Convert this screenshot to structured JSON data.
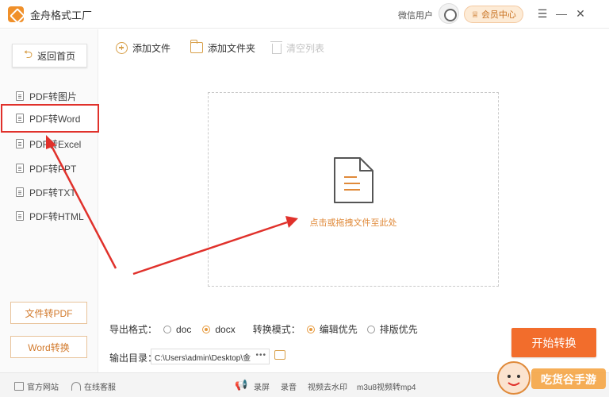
{
  "titlebar": {
    "app_title": "金舟格式工厂",
    "user_name": "微信用户",
    "member_center": "会员中心",
    "menu_glyph": "☰",
    "minimize_glyph": "—",
    "close_glyph": "✕"
  },
  "sidebar": {
    "back_label": "返回首页",
    "items": [
      {
        "label": "PDF转图片",
        "active": false
      },
      {
        "label": "PDF转Word",
        "active": true
      },
      {
        "label": "PDF转Excel",
        "active": false
      },
      {
        "label": "PDF转PPT",
        "active": false
      },
      {
        "label": "PDF转TXT",
        "active": false
      },
      {
        "label": "PDF转HTML",
        "active": false
      }
    ],
    "file_to_pdf": "文件转PDF",
    "word_convert": "Word转换"
  },
  "toolbar": {
    "add_file": "添加文件",
    "add_folder": "添加文件夹",
    "clear_list": "清空列表"
  },
  "drop_zone": {
    "hint": "点击或拖拽文件至此处"
  },
  "settings": {
    "export_format_label": "导出格式：",
    "format_options": [
      {
        "label": "doc",
        "checked": false
      },
      {
        "label": "docx",
        "checked": true
      }
    ],
    "mode_label": "转换模式：",
    "mode_options": [
      {
        "label": "编辑优先",
        "checked": true
      },
      {
        "label": "排版优先",
        "checked": false
      }
    ],
    "output_dir_label": "输出目录：",
    "output_dir_value": "C:\\Users\\admin\\Desktop\\金",
    "output_more": "•••",
    "start_button": "开始转换"
  },
  "footer": {
    "website": "官方网站",
    "support": "在线客服",
    "record_screen": "录屏",
    "record_audio": "录音",
    "remove_watermark": "视频去水印",
    "m3u8": "m3u8视频转mp4"
  },
  "watermark": {
    "text": "吃货谷手游"
  },
  "colors": {
    "accent": "#f26d2c",
    "highlight": "#e0312b",
    "brand_orange": "#e08a3a"
  }
}
